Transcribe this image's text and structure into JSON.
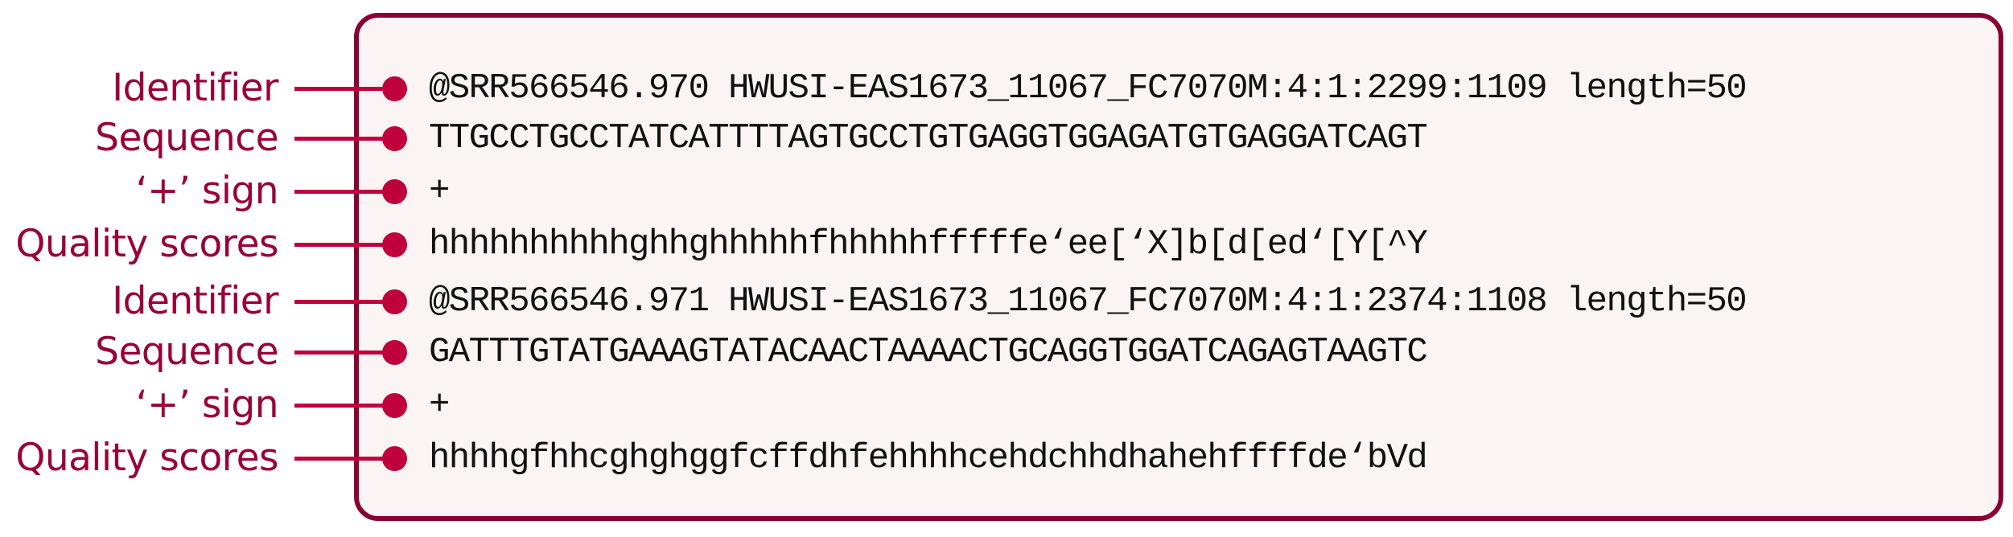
{
  "colors": {
    "accent": "#c0003c",
    "label": "#9a0038",
    "border": "#8a0033",
    "box_background": "#faf4f5",
    "text": "#111111"
  },
  "rows": [
    {
      "label": "Identifier",
      "value": "@SRR566546.970 HWUSI-EAS1673_11067_FC7070M:4:1:2299:1109 length=50"
    },
    {
      "label": "Sequence",
      "value": "TTGCCTGCCTATCATTTTAGTGCCTGTGAGGTGGAGATGTGAGGATCAGT"
    },
    {
      "label": "‘+’ sign",
      "value": "+"
    },
    {
      "label": "Quality scores",
      "value": "hhhhhhhhhhghhghhhhhfhhhhhfffffe‘ee[‘X]b[d[ed‘[Y[^Y"
    },
    {
      "label": "Identifier",
      "value": "@SRR566546.971 HWUSI-EAS1673_11067_FC7070M:4:1:2374:1108 length=50"
    },
    {
      "label": "Sequence",
      "value": "GATTTGTATGAAAGTATACAACTAAAACTGCAGGTGGATCAGAGTAAGTC"
    },
    {
      "label": "‘+’ sign",
      "value": "+"
    },
    {
      "label": "Quality scores",
      "value": "hhhhgfhhcghghggfcffdhfehhhhcehdchhdhahehffffde‘bVd"
    }
  ]
}
